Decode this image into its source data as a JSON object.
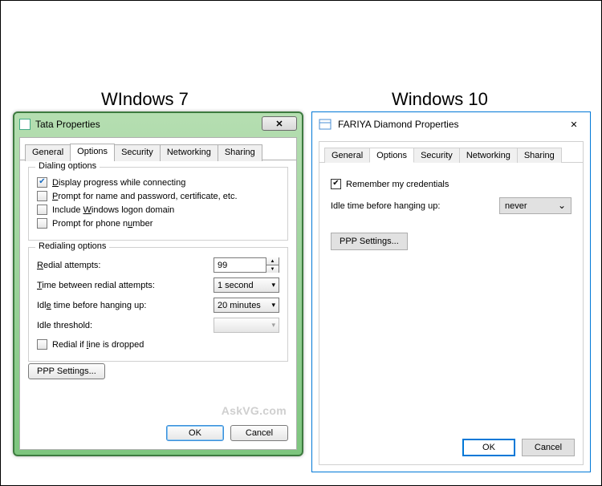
{
  "labels": {
    "w7": "WIndows 7",
    "w10": "Windows 10"
  },
  "watermark": "AskVG.com",
  "win7": {
    "title": "Tata Properties",
    "tabs": [
      "General",
      "Options",
      "Security",
      "Networking",
      "Sharing"
    ],
    "active_tab": 1,
    "groups": {
      "dialing": {
        "title": "Dialing options",
        "display_progress": {
          "label": "Display progress while connecting",
          "checked": true
        },
        "prompt_name": {
          "label": "Prompt for name and password, certificate, etc.",
          "checked": false
        },
        "include_logon": {
          "label": "Include Windows logon domain",
          "checked": false
        },
        "prompt_phone": {
          "label": "Prompt for phone number",
          "checked": false
        }
      },
      "redialing": {
        "title": "Redialing options",
        "redial_attempts": {
          "label": "Redial attempts:",
          "value": "99"
        },
        "time_between": {
          "label": "Time between redial attempts:",
          "value": "1 second"
        },
        "idle_time": {
          "label": "Idle time before hanging up:",
          "value": "20 minutes"
        },
        "idle_threshold": {
          "label": "Idle threshold:",
          "value": ""
        },
        "redial_dropped": {
          "label": "Redial if line is dropped",
          "checked": false
        }
      }
    },
    "ppp_button": "PPP Settings...",
    "ok": "OK",
    "cancel": "Cancel"
  },
  "win10": {
    "title": "FARIYA Diamond Properties",
    "tabs": [
      "General",
      "Options",
      "Security",
      "Networking",
      "Sharing"
    ],
    "active_tab": 1,
    "remember": {
      "label": "Remember my credentials",
      "checked": true
    },
    "idle": {
      "label": "Idle time before hanging up:",
      "value": "never"
    },
    "ppp_button": "PPP Settings...",
    "ok": "OK",
    "cancel": "Cancel"
  }
}
